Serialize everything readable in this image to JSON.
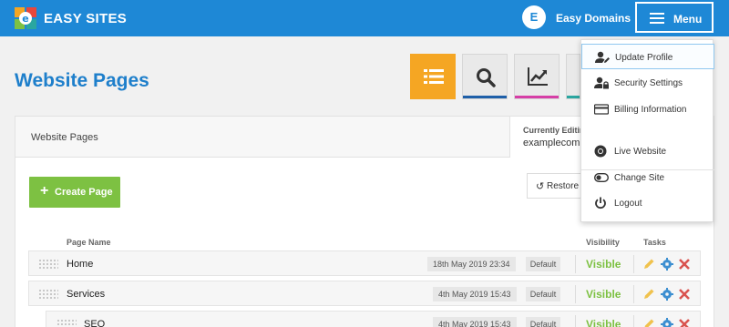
{
  "header": {
    "brand": "EASY SITES",
    "user_initial": "E",
    "user_name": "Easy Domains",
    "menu_label": "Menu",
    "color": "#1e88d6"
  },
  "page": {
    "title": "Website Pages",
    "toolbar": [
      {
        "icon": "list-icon",
        "active": true
      },
      {
        "icon": "search-icon",
        "underline": "#1e5fa8"
      },
      {
        "icon": "analytics-chart-icon",
        "underline": "#d63ea6"
      },
      {
        "icon": "settings-icon",
        "underline": "#2aa6a0"
      }
    ]
  },
  "panel": {
    "tab_label": "Website Pages",
    "currently_editing_label": "Currently Editing",
    "currently_editing_value": "examplecompa"
  },
  "actions": {
    "create_page": "Create Page",
    "restore": "Restore"
  },
  "table": {
    "headers": {
      "name": "Page Name",
      "visibility": "Visibility",
      "tasks": "Tasks"
    },
    "rows": [
      {
        "name": "Home",
        "date": "18th May 2019 23:34",
        "role": "Default",
        "visibility": "Visible"
      },
      {
        "name": "Services",
        "date": "4th May 2019 15:43",
        "role": "Default",
        "visibility": "Visible"
      },
      {
        "name": "SEO",
        "date": "4th May 2019 15:43",
        "role": "Default",
        "visibility": "Visible",
        "child": true
      }
    ]
  },
  "menu": {
    "items": [
      {
        "label": "Update Profile",
        "icon": "user-edit-icon",
        "active": true
      },
      {
        "label": "Security Settings",
        "icon": "user-lock-icon"
      },
      {
        "label": "Billing Information",
        "icon": "credit-card-icon"
      },
      {
        "label": "Live Website",
        "icon": "chrome-icon"
      },
      {
        "label": "Change Site",
        "icon": "toggle-icon"
      },
      {
        "label": "Logout",
        "icon": "power-icon"
      }
    ]
  },
  "colors": {
    "accent_blue": "#1e88d6",
    "active_orange": "#f5a623",
    "green": "#7dc142",
    "delete_red": "#d9534f",
    "edit_yellow": "#f0c24d",
    "gear_blue": "#3d8fd1"
  }
}
